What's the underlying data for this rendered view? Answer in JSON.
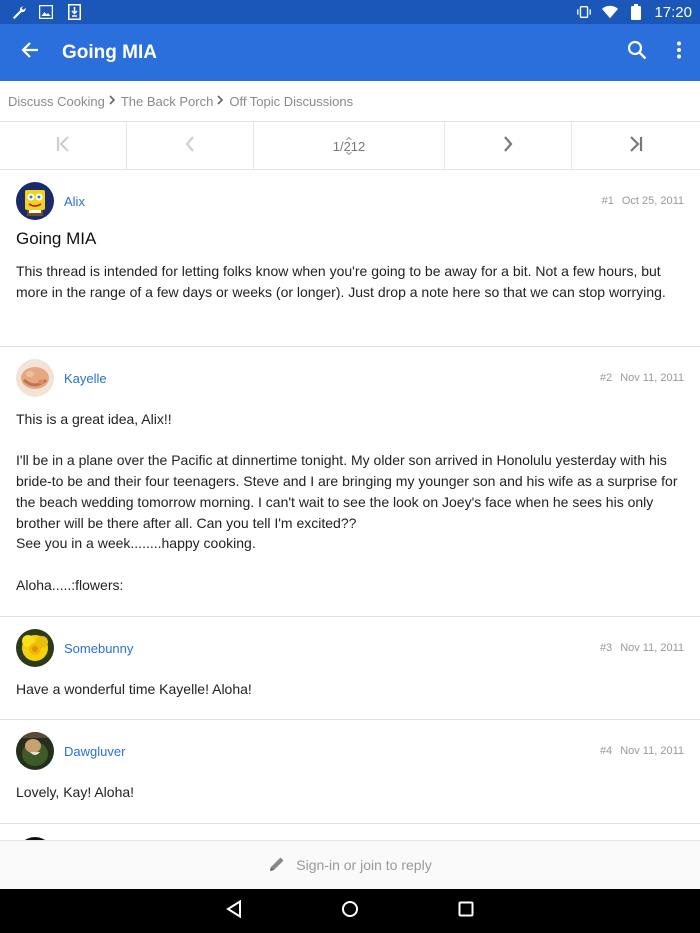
{
  "status_bar": {
    "time": "17:20",
    "left_icons": [
      "wrench-icon",
      "image-icon",
      "download-icon"
    ],
    "right_icons": [
      "vibrate-icon",
      "wifi-icon",
      "battery-icon"
    ]
  },
  "app_bar": {
    "title": "Going MIA",
    "icons": [
      "back-arrow-icon",
      "search-icon",
      "more-vert-icon"
    ],
    "color": "#2a6fdb"
  },
  "breadcrumb": [
    {
      "label": "Discuss Cooking"
    },
    {
      "label": "The Back Porch"
    },
    {
      "label": "Off Topic Discussions"
    }
  ],
  "pager": {
    "current": "1",
    "total": "212",
    "icons": [
      "first-page-icon",
      "prev-page-icon",
      "next-page-icon",
      "last-page-icon"
    ]
  },
  "posts": [
    {
      "author": "Alix",
      "number": "#1",
      "date": "Oct 25, 2011",
      "title": "Going MIA",
      "body": [
        "This thread is intended for letting folks know when you're going to be away for a bit. Not a few hours, but more in the range of a few days or weeks (or longer). Just drop a note here so that we can stop worrying."
      ]
    },
    {
      "author": "Kayelle",
      "number": "#2",
      "date": "Nov 11, 2011",
      "body": [
        "This is a great idea, Alix!!",
        "",
        "I'll be in a plane over the Pacific at dinnertime tonight. My older son arrived in Honolulu yesterday with his bride-to be and their four teenagers. Steve and I are bringing my younger son and his wife as a surprise for the beach wedding tomorrow morning. I can't wait to see the look on Joey's face when he sees his only brother will be there after all. Can you tell I'm excited??",
        "See you in a week........happy cooking.",
        "",
        "Aloha.....:flowers:"
      ]
    },
    {
      "author": "Somebunny",
      "number": "#3",
      "date": "Nov 11, 2011",
      "body": [
        "Have a wonderful time Kayelle! Aloha!"
      ]
    },
    {
      "author": "Dawgluver",
      "number": "#4",
      "date": "Nov 11, 2011",
      "body": [
        "Lovely, Kay! Aloha!"
      ]
    }
  ],
  "reply_bar": {
    "label": "Sign-in or join to reply",
    "icon": "pencil-icon"
  },
  "nav_bar": {
    "icons": [
      "back-triangle-icon",
      "home-circle-icon",
      "recents-square-icon"
    ]
  }
}
